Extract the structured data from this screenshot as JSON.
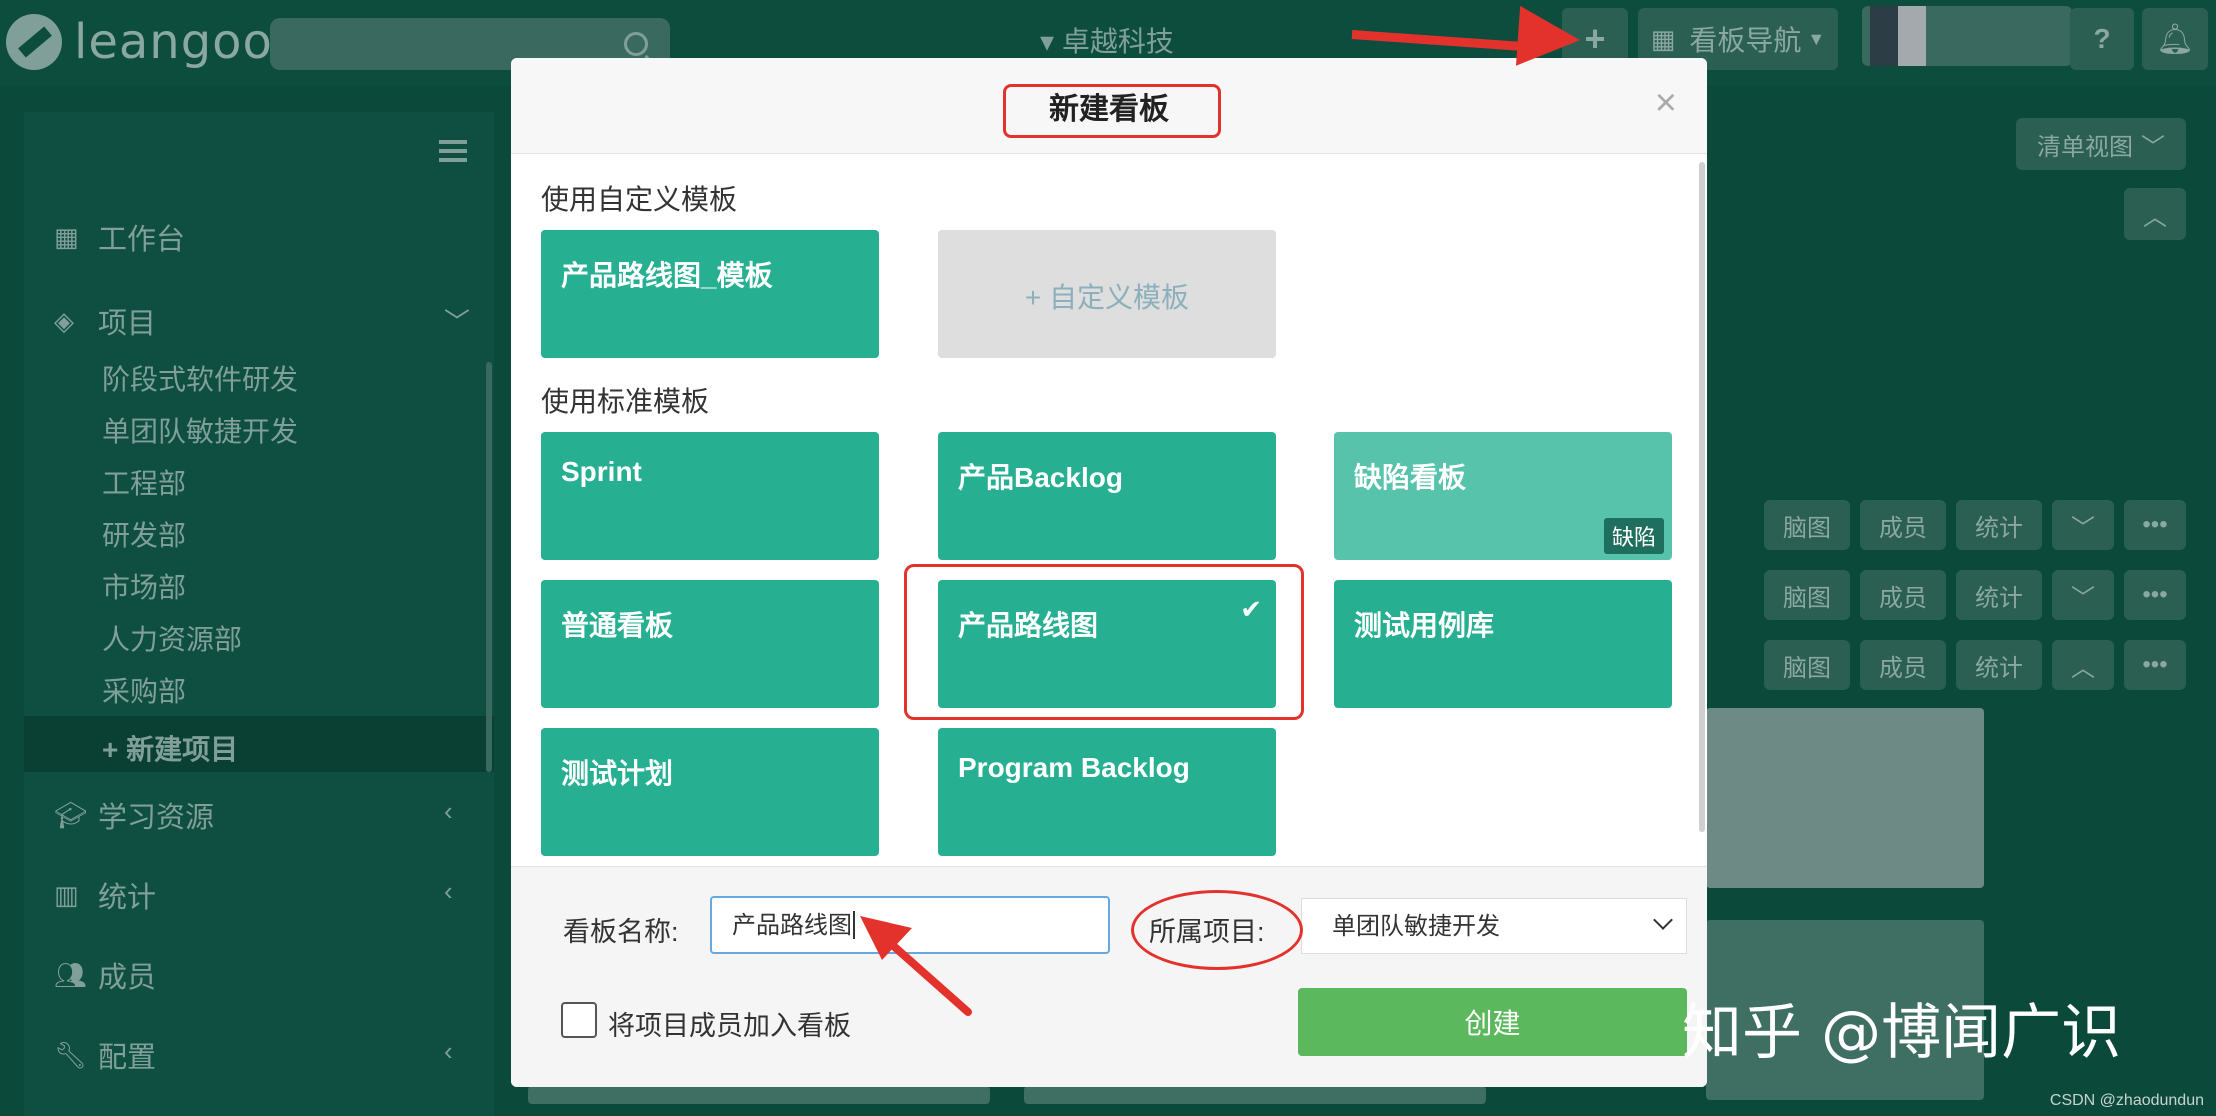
{
  "topbar": {
    "logo_text": "leangoo",
    "org_name": "卓越科技",
    "add_icon": "plus-icon",
    "board_nav_label": "看板导航",
    "help_label": "?",
    "bell_icon": "bell-icon"
  },
  "sidebar": {
    "workspace": "工作台",
    "projects": "项目",
    "project_items": [
      "阶段式软件研发",
      "单团队敏捷开发",
      "工程部",
      "研发部",
      "市场部",
      "人力资源部",
      "采购部"
    ],
    "new_project": "+ 新建项目",
    "learning": "学习资源",
    "stats": "统计",
    "members": "成员",
    "config": "配置"
  },
  "right_panel": {
    "list_view": "清单视图",
    "row_buttons": [
      "脑图",
      "成员",
      "统计"
    ],
    "more": "•••"
  },
  "modal": {
    "title": "新建看板",
    "close": "×",
    "custom_section": "使用自定义模板",
    "custom_templates": [
      "产品路线图_模板"
    ],
    "add_custom": "+ 自定义模板",
    "standard_section": "使用标准模板",
    "standard_templates": {
      "sprint": "Sprint",
      "backlog": "产品Backlog",
      "defect": "缺陷看板",
      "defect_tag": "缺陷",
      "normal": "普通看板",
      "roadmap": "产品路线图",
      "testcase": "测试用例库",
      "testplan": "测试计划",
      "program": "Program Backlog"
    },
    "selected_check": "✔",
    "name_label": "看板名称:",
    "name_value": "产品路线图",
    "project_label": "所属项目:",
    "project_value": "单团队敏捷开发",
    "add_members_label": "将项目成员加入看板",
    "create_label": "创建"
  },
  "watermark": "知乎 @博闻广识",
  "credit": "CSDN @zhaodundun",
  "colors": {
    "template_green": "#26b091",
    "create_green": "#5cb85c",
    "annotation_red": "#e3322b"
  }
}
